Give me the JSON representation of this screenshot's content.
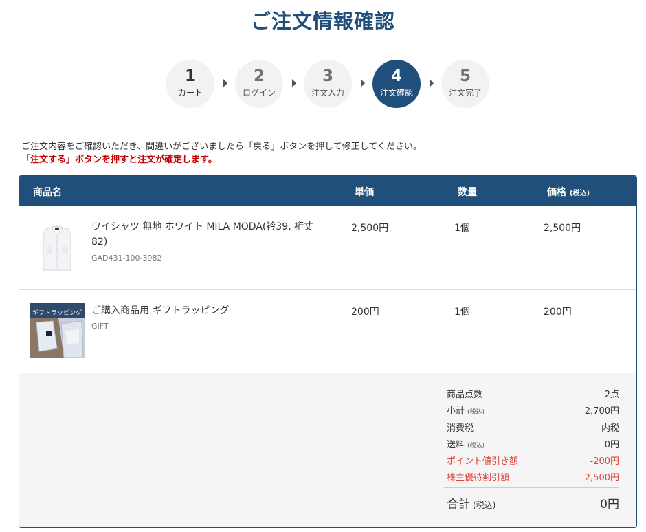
{
  "page": {
    "title": "ご注文情報確認"
  },
  "steps": [
    {
      "num": "1",
      "label": "カート"
    },
    {
      "num": "2",
      "label": "ログイン"
    },
    {
      "num": "3",
      "label": "注文入力"
    },
    {
      "num": "4",
      "label": "注文確認"
    },
    {
      "num": "5",
      "label": "注文完了"
    }
  ],
  "active_step": 4,
  "notice": {
    "line1": "ご注文内容をご確認いただき、間違いがございましたら「戻る」ボタンを押して修正してください。",
    "line2": "「注文する」ボタンを押すと注文が確定します。"
  },
  "table": {
    "headers": {
      "name": "商品名",
      "unit_price": "単価",
      "qty": "数量",
      "price": "価格",
      "price_tax": "(税込)"
    },
    "items": [
      {
        "name": "ワイシャツ 無地 ホワイト MILA MODA(衿39, 裄丈82)",
        "code": "GAD431-100-3982",
        "unit_price": "2,500円",
        "qty": "1個",
        "price": "2,500円",
        "image": "white-dress-shirt-image"
      },
      {
        "name": "ご購入商品用 ギフトラッピング",
        "code": "GIFT",
        "unit_price": "200円",
        "qty": "1個",
        "price": "200円",
        "image": "gift-wrapping-image",
        "image_text": "ギフトラッピング"
      }
    ]
  },
  "summary": {
    "count_label": "商品点数",
    "count_value": "2点",
    "subtotal_label": "小計",
    "subtotal_tax": "(税込)",
    "subtotal_value": "2,700円",
    "tax_label": "消費税",
    "tax_value": "内税",
    "shipping_label": "送料",
    "shipping_tax": "(税込)",
    "shipping_value": "0円",
    "points_label": "ポイント値引き額",
    "points_value": "-200円",
    "shareholder_label": "株主優待割引額",
    "shareholder_value": "-2,500円",
    "total_label": "合計",
    "total_tax": "(税込)",
    "total_value": "0円"
  },
  "colors": {
    "brand": "#1f4f7a",
    "warning": "#c40000",
    "discount": "#e0443a"
  }
}
